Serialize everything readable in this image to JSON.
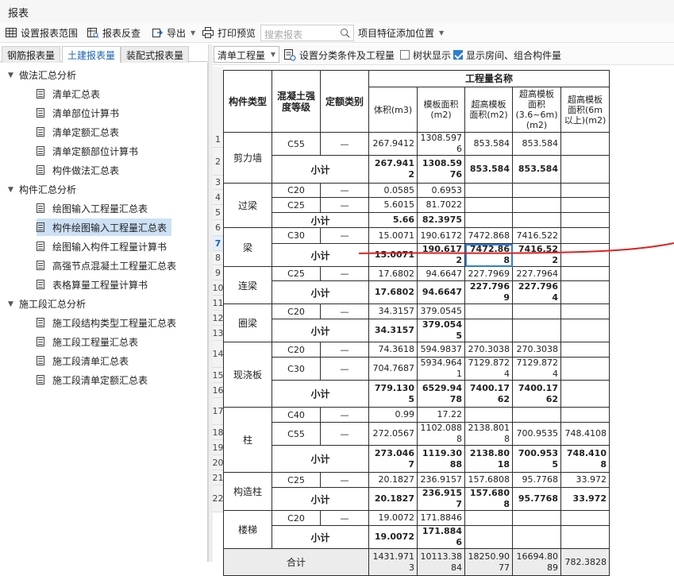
{
  "window": {
    "title": "报表"
  },
  "toolbar": {
    "set_scope": "设置报表范围",
    "report_check": "报表反查",
    "export": "导出",
    "print_preview": "打印预览",
    "search_placeholder": "搜索报表",
    "add_feature": "项目特征添加位置"
  },
  "left_tabs": [
    "钢筋报表量",
    "土建报表量",
    "装配式报表量"
  ],
  "tree": {
    "groups": [
      {
        "label": "做法汇总分析",
        "items": [
          "清单汇总表",
          "清单部位计算书",
          "清单定额汇总表",
          "清单定额部位计算书",
          "构件做法汇总表"
        ]
      },
      {
        "label": "构件汇总分析",
        "items": [
          "绘图输入工程量汇总表",
          "构件绘图输入工程量汇总表",
          "绘图输入构件工程量计算书",
          "高强节点混凝土工程量汇总表",
          "表格算量工程量计算书"
        ]
      },
      {
        "label": "施工段汇总分析",
        "items": [
          "施工段结构类型工程量汇总表",
          "施工段工程量汇总表",
          "施工段清单汇总表",
          "施工段清单定额汇总表"
        ]
      }
    ],
    "selected": "构件绘图输入工程量汇总表"
  },
  "right_toolbar": {
    "combo_value": "清单工程量",
    "set_classify": "设置分类条件及工程量",
    "tree_display": "树状显示",
    "tree_display_checked": false,
    "show_rooms": "显示房间、组合构件量",
    "show_rooms_checked": true
  },
  "table": {
    "headers": {
      "type": "构件类型",
      "grade": "混凝土强度等级",
      "quota": "定额类别",
      "group": "工程量名称",
      "volume": "体积(m3)",
      "formwork": "模板面积(m2)",
      "super_formwork": "超高模板面积(m2)",
      "super_36": "超高模板面积(3.6~6m)(m2)",
      "super_6": "超高模板面积(6m以上)(m2)"
    },
    "rows": [
      {
        "n": "1",
        "type": "剪力墙",
        "grade": "C55",
        "quota": "—",
        "v": "267.9412",
        "f": "1308.5976",
        "s": "853.584",
        "s36": "853.584",
        "s6": ""
      },
      {
        "n": "2",
        "sum": "小计",
        "v": "267.9412",
        "f": "1308.5976",
        "s": "853.584",
        "s36": "853.584",
        "s6": ""
      },
      {
        "n": "3",
        "type": "过梁",
        "grade": "C20",
        "quota": "—",
        "v": "0.0585",
        "f": "0.6953",
        "s": "",
        "s36": "",
        "s6": ""
      },
      {
        "n": "4",
        "grade": "C25",
        "quota": "—",
        "v": "5.6015",
        "f": "81.7022",
        "s": "",
        "s36": "",
        "s6": ""
      },
      {
        "n": "5",
        "sum": "小计",
        "v": "5.66",
        "f": "82.3975",
        "s": "",
        "s36": "",
        "s6": ""
      },
      {
        "n": "6",
        "type": "梁",
        "grade": "C30",
        "quota": "—",
        "v": "15.0071",
        "f": "190.6172",
        "s": "7472.868",
        "s36": "7416.522",
        "s6": ""
      },
      {
        "n": "7",
        "sum": "小计",
        "v": "15.0071",
        "f": "190.6172",
        "s": "7472.868",
        "s36": "7416.522",
        "s6": ""
      },
      {
        "n": "8",
        "type": "连梁",
        "grade": "C25",
        "quota": "—",
        "v": "17.6802",
        "f": "94.6647",
        "s": "227.7969",
        "s36": "227.7964",
        "s6": ""
      },
      {
        "n": "9",
        "sum": "小计",
        "v": "17.6802",
        "f": "94.6647",
        "s": "227.7969",
        "s36": "227.7964",
        "s6": ""
      },
      {
        "n": "10",
        "type": "圈梁",
        "grade": "C20",
        "quota": "—",
        "v": "34.3157",
        "f": "379.0545",
        "s": "",
        "s36": "",
        "s6": ""
      },
      {
        "n": "11",
        "sum": "小计",
        "v": "34.3157",
        "f": "379.0545",
        "s": "",
        "s36": "",
        "s6": ""
      },
      {
        "n": "12",
        "type": "现浇板",
        "grade": "C20",
        "quota": "—",
        "v": "74.3618",
        "f": "594.9837",
        "s": "270.3038",
        "s36": "270.3038",
        "s6": ""
      },
      {
        "n": "13",
        "grade": "C30",
        "quota": "—",
        "v": "704.7687",
        "f": "5934.9641",
        "s": "7129.8724",
        "s36": "7129.8724",
        "s6": ""
      },
      {
        "n": "14",
        "sum": "小计",
        "v": "779.1305",
        "f": "6529.9478",
        "s": "7400.1762",
        "s36": "7400.1762",
        "s6": ""
      },
      {
        "n": "15",
        "type": "柱",
        "grade": "C40",
        "quota": "—",
        "v": "0.99",
        "f": "17.22",
        "s": "",
        "s36": "",
        "s6": ""
      },
      {
        "n": "16",
        "grade": "C55",
        "quota": "—",
        "v": "272.0567",
        "f": "1102.0888",
        "s": "2138.8018",
        "s36": "700.9535",
        "s6": "748.4108"
      },
      {
        "n": "17",
        "sum": "小计",
        "v": "273.0467",
        "f": "1119.3088",
        "s": "2138.8018",
        "s36": "700.9535",
        "s6": "748.4108"
      },
      {
        "n": "18",
        "type": "构造柱",
        "grade": "C25",
        "quota": "—",
        "v": "20.1827",
        "f": "236.9157",
        "s": "157.6808",
        "s36": "95.7768",
        "s6": "33.972"
      },
      {
        "n": "19",
        "sum": "小计",
        "v": "20.1827",
        "f": "236.9157",
        "s": "157.6808",
        "s36": "95.7768",
        "s6": "33.972"
      },
      {
        "n": "20",
        "type": "楼梯",
        "grade": "C20",
        "quota": "—",
        "v": "19.0072",
        "f": "171.8846",
        "s": "",
        "s36": "",
        "s6": ""
      },
      {
        "n": "21",
        "sum": "小计",
        "v": "19.0072",
        "f": "171.8846",
        "s": "",
        "s36": "",
        "s6": ""
      },
      {
        "n": "22",
        "total": "合计",
        "v": "1431.9713",
        "f": "10113.3884",
        "s": "18250.9077",
        "s36": "16694.8089",
        "s6": "782.3828"
      }
    ]
  },
  "colors": {
    "selection": "#cce1f5",
    "active_tab": "#1a62b4",
    "annotation": "#e02020",
    "focus_cell": "#2f7fd7"
  }
}
